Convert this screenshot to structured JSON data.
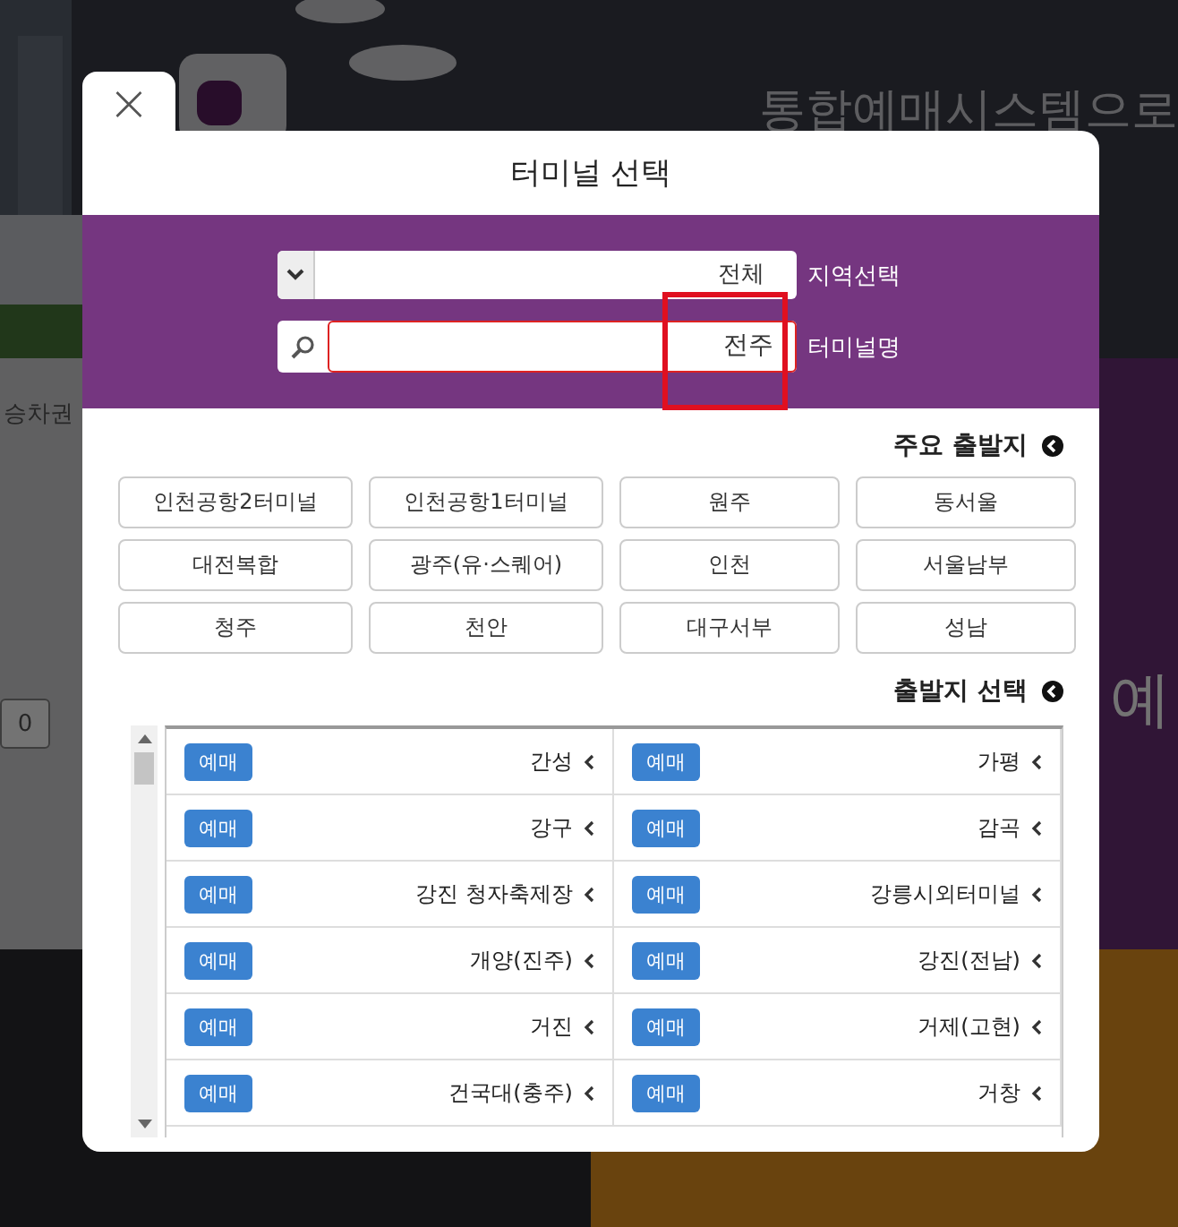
{
  "background": {
    "headline": "통합예매시스템으로",
    "tab": "승차권",
    "side": "예",
    "counter": "0"
  },
  "modal": {
    "title": "터미널 선택",
    "close": "×",
    "region": {
      "label": "지역선택",
      "value": "전체"
    },
    "terminal": {
      "label": "터미널명",
      "value": "전주"
    },
    "major": {
      "title": "주요 출발지",
      "items": [
        "인천공항2터미널",
        "인천공항1터미널",
        "원주",
        "동서울",
        "대전복합",
        "광주(유·스퀘어)",
        "인천",
        "서울남부",
        "청주",
        "천안",
        "대구서부",
        "성남"
      ]
    },
    "departures": {
      "title": "출발지 선택",
      "rows": [
        [
          {
            "name": "간성",
            "button": "예매"
          },
          {
            "name": "가평",
            "button": "예매"
          }
        ],
        [
          {
            "name": "강구",
            "button": "예매"
          },
          {
            "name": "감곡",
            "button": "예매"
          }
        ],
        [
          {
            "name": "강진 청자축제장",
            "button": "예매"
          },
          {
            "name": "강릉시외터미널",
            "button": "예매"
          }
        ],
        [
          {
            "name": "개양(진주)",
            "button": "예매"
          },
          {
            "name": "강진(전남)",
            "button": "예매"
          }
        ],
        [
          {
            "name": "거진",
            "button": "예매"
          },
          {
            "name": "거제(고현)",
            "button": "예매"
          }
        ],
        [
          {
            "name": "건국대(충주)",
            "button": "예매"
          },
          {
            "name": "거창",
            "button": "예매"
          }
        ]
      ]
    }
  }
}
